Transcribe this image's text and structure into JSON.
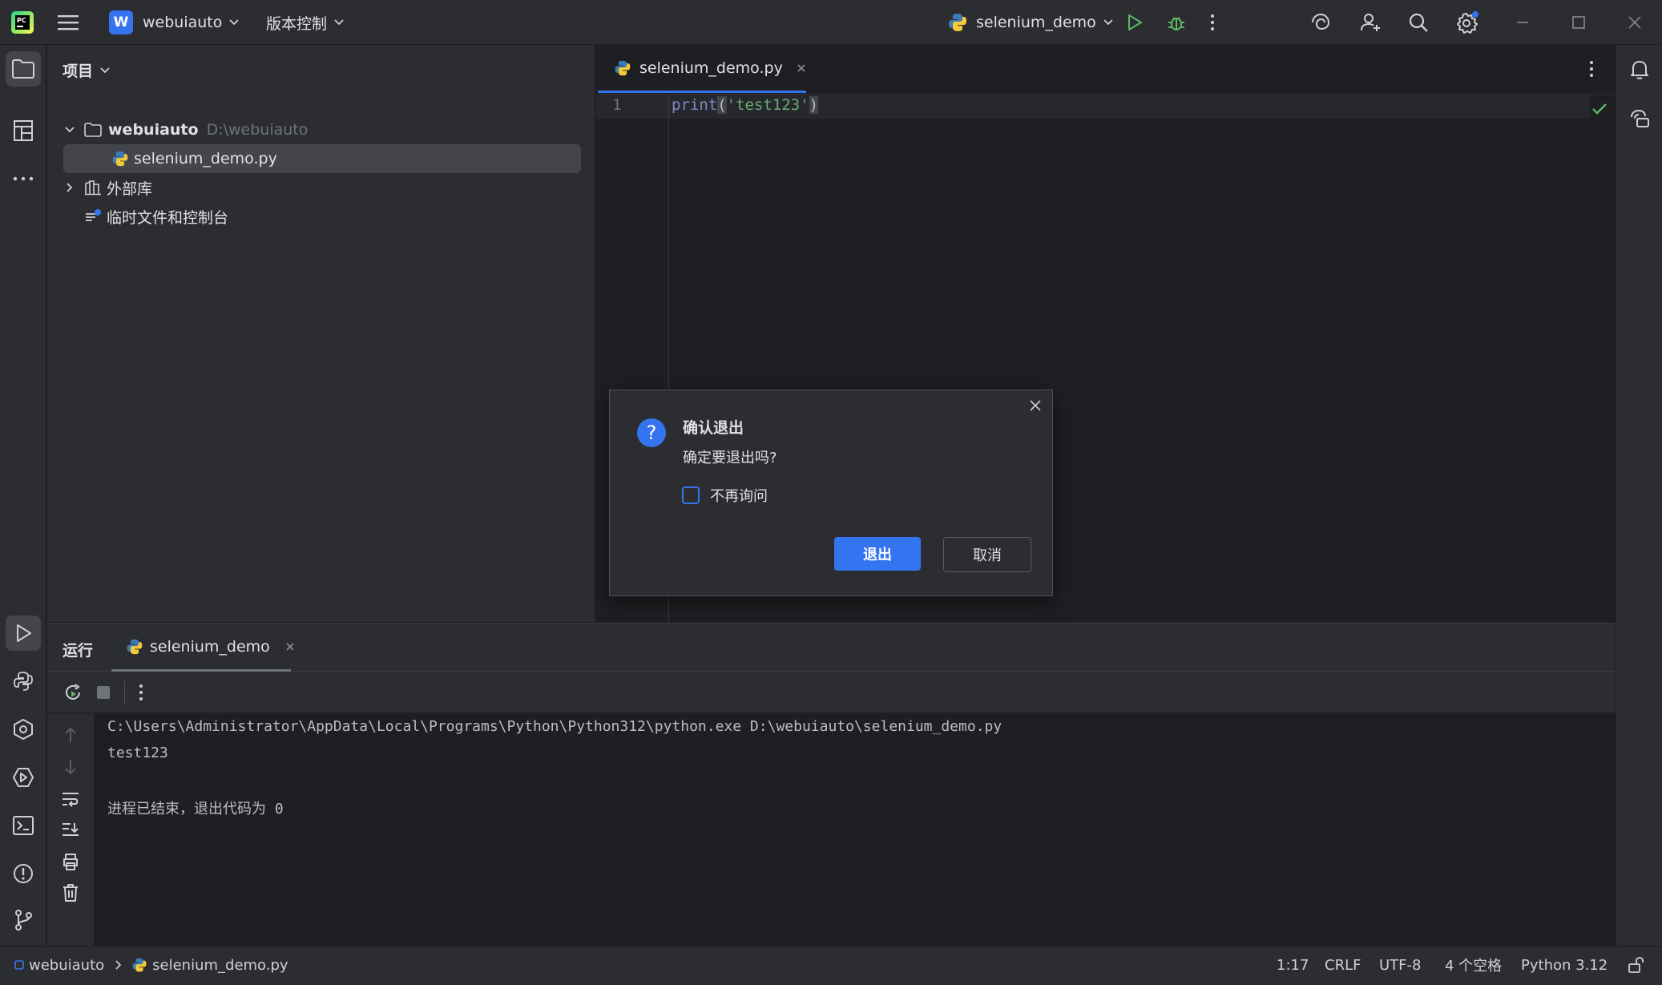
{
  "titlebar": {
    "project_initial": "W",
    "project_name": "webuiauto",
    "vcs_label": "版本控制",
    "run_config": "selenium_demo"
  },
  "project_panel": {
    "title": "项目",
    "root_name": "webuiauto",
    "root_path": "D:\\webuiauto",
    "file_name": "selenium_demo.py",
    "external_libs": "外部库",
    "scratches": "临时文件和控制台"
  },
  "editor": {
    "tab_label": "selenium_demo.py",
    "line_number": "1",
    "code": {
      "func": "print",
      "open_paren": "(",
      "string": "'test123'",
      "close_paren": ")"
    }
  },
  "dialog": {
    "title": "确认退出",
    "message": "确定要退出吗?",
    "checkbox_label": "不再询问",
    "checkbox_checked": false,
    "primary_button": "退出",
    "secondary_button": "取消"
  },
  "run_panel": {
    "title": "运行",
    "tab_label": "selenium_demo",
    "console": [
      "C:\\Users\\Administrator\\AppData\\Local\\Programs\\Python\\Python312\\python.exe D:\\webuiauto\\selenium_demo.py",
      "test123",
      "",
      "进程已结束，退出代码为 0"
    ]
  },
  "statusbar": {
    "breadcrumb_project": "webuiauto",
    "breadcrumb_file": "selenium_demo.py",
    "position": "1:17",
    "line_sep": "CRLF",
    "encoding": "UTF-8",
    "indent": "4 个空格",
    "interpreter": "Python 3.12"
  },
  "colors": {
    "accent": "#3574f0",
    "run_green": "#5fb865",
    "string_green": "#6aab73",
    "builtin_blue": "#8888c6",
    "background": "#1e1f22",
    "panel": "#2b2d30"
  }
}
